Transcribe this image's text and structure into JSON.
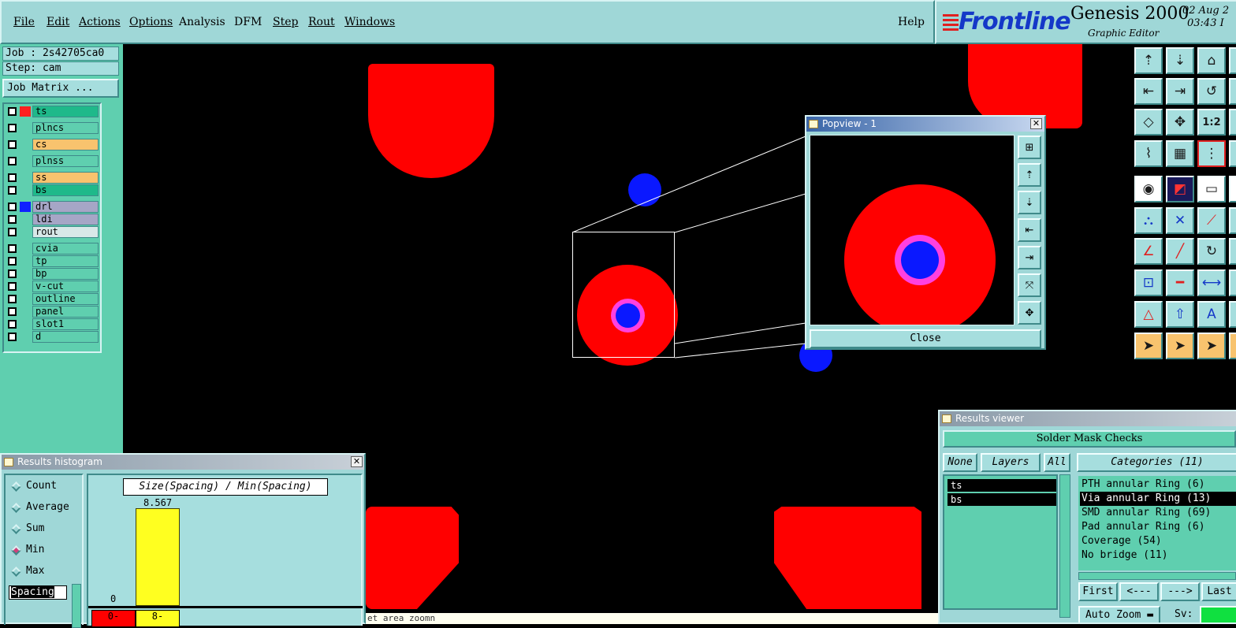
{
  "menubar": {
    "items": [
      "File",
      "Edit",
      "Actions",
      "Options",
      "Analysis",
      "DFM",
      "Step",
      "Rout",
      "Windows"
    ],
    "help": "Help"
  },
  "brand": {
    "logo": "Frontline",
    "title": "Genesis 2000",
    "subtitle": "Graphic Editor",
    "date": "02 Aug 2",
    "time": "03:43 I"
  },
  "left_panel": {
    "job": "Job : 2s42705ca0",
    "step": "Step: cam",
    "job_matrix": "Job Matrix ...",
    "layers": [
      {
        "name": "ts",
        "swatch": "#ff2020",
        "bg": "#1fb98a"
      },
      {
        "name": "plncs",
        "swatch": "",
        "bg": "#5fcfaf"
      },
      {
        "name": "cs",
        "swatch": "",
        "bg": "#f8c36e"
      },
      {
        "name": "plnss",
        "swatch": "",
        "bg": "#5fcfaf"
      },
      {
        "name": "ss",
        "swatch": "",
        "bg": "#f8c36e"
      },
      {
        "name": "bs",
        "swatch": "",
        "bg": "#1fb98a"
      },
      {
        "name": "drl",
        "swatch": "#1020ff",
        "bg": "#a6a6c6"
      },
      {
        "name": "ldi",
        "swatch": "",
        "bg": "#a6a6c6"
      },
      {
        "name": "rout",
        "swatch": "",
        "bg": "#d8e8e8"
      },
      {
        "name": "cvia",
        "swatch": "",
        "bg": "#5fcfaf"
      },
      {
        "name": "tp",
        "swatch": "",
        "bg": "#5fcfaf"
      },
      {
        "name": "bp",
        "swatch": "",
        "bg": "#5fcfaf"
      },
      {
        "name": "v-cut",
        "swatch": "",
        "bg": "#5fcfaf"
      },
      {
        "name": "outline",
        "swatch": "",
        "bg": "#5fcfaf"
      },
      {
        "name": "panel",
        "swatch": "",
        "bg": "#5fcfaf"
      },
      {
        "name": "slot1",
        "swatch": "",
        "bg": "#5fcfaf"
      },
      {
        "name": "d",
        "swatch": "",
        "bg": "#5fcfaf"
      }
    ]
  },
  "popview": {
    "title": "Popview - 1",
    "close": "Close"
  },
  "histogram": {
    "title": "Results histogram",
    "modes": [
      "Count",
      "Average",
      "Sum",
      "Min",
      "Max"
    ],
    "selected_mode": "Min",
    "field": "Spacing",
    "chart_title": "Size(Spacing) / Min(Spacing)",
    "bar_value": "8.567",
    "zero_label": "0",
    "bin_labels": [
      "0-",
      "8-"
    ]
  },
  "viewer": {
    "title": "Results viewer",
    "header": "Solder Mask Checks",
    "none": "None",
    "layers_btn": "Layers",
    "all": "All",
    "categories_btn": "Categories (11)",
    "layers": [
      "ts",
      "bs"
    ],
    "categories": [
      "PTH annular Ring (6)",
      "Via annular Ring (13)",
      "SMD annular Ring (69)",
      "Pad annular Ring (6)",
      "Coverage (54)",
      "No bridge (11)"
    ],
    "selected_category": 1,
    "nav": [
      "First",
      "<---",
      "--->",
      "Last"
    ],
    "zoom": "Auto Zoom",
    "sv": "Sv:"
  },
  "status_text": "et area zoomn",
  "colors": {
    "copper": "#ff0000",
    "drill": "#0a18ff",
    "clearance": "#ff40e0",
    "panel": "#9fd7d7"
  }
}
